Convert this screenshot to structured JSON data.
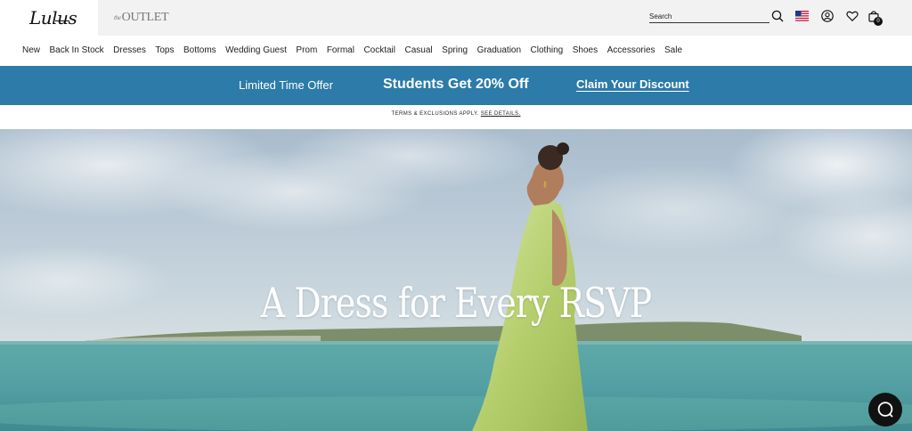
{
  "header": {
    "logo_text": "Lulus",
    "outlet_the": "the",
    "outlet_text": "OUTLET",
    "search_placeholder": "Search",
    "bag_count": "0",
    "icons": [
      "search-icon",
      "us-flag-icon",
      "account-icon",
      "heart-icon",
      "shopping-bag-icon"
    ]
  },
  "nav": {
    "items": [
      "New",
      "Back In Stock",
      "Dresses",
      "Tops",
      "Bottoms",
      "Wedding Guest",
      "Prom",
      "Formal",
      "Cocktail",
      "Casual",
      "Spring",
      "Graduation",
      "Clothing",
      "Shoes",
      "Accessories",
      "Sale"
    ]
  },
  "promo": {
    "left": "Limited Time Offer",
    "middle": "Students Get 20% Off",
    "cta": "Claim Your Discount",
    "color": "#2c7ba8"
  },
  "terms": {
    "text": "TERMS & EXCLUSIONS APPLY.",
    "link": "SEE DETAILS."
  },
  "hero": {
    "title": "A Dress for Every RSVP"
  },
  "chat": {
    "icon": "chat-bubble-icon"
  }
}
